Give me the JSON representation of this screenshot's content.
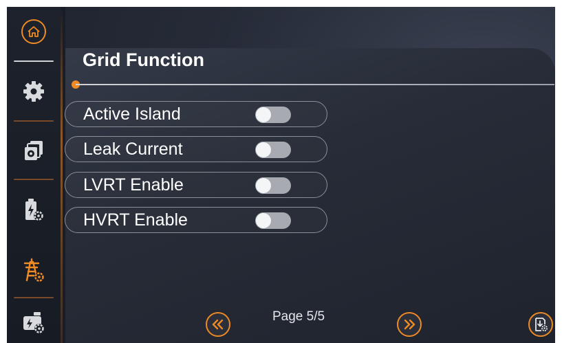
{
  "sidebar": {
    "items": [
      {
        "name": "home",
        "icon": "home-icon"
      },
      {
        "name": "settings",
        "icon": "gear-icon"
      },
      {
        "name": "devices",
        "icon": "device-stack-gear-icon"
      },
      {
        "name": "battery",
        "icon": "battery-gear-icon"
      },
      {
        "name": "grid",
        "icon": "power-tower-gear-icon",
        "active": true
      },
      {
        "name": "generator",
        "icon": "generator-gear-icon"
      }
    ]
  },
  "header": {
    "title": "Grid Function"
  },
  "settings": [
    {
      "label": "Active Island",
      "enabled": false
    },
    {
      "label": "Leak Current",
      "enabled": false
    },
    {
      "label": "LVRT Enable",
      "enabled": false
    },
    {
      "label": "HVRT Enable",
      "enabled": false
    }
  ],
  "pager": {
    "label": "Page 5/5",
    "current": 5,
    "total": 5
  },
  "colors": {
    "accent": "#f08a24",
    "background": "#191d27",
    "toggle_off": "#a7abb1"
  }
}
